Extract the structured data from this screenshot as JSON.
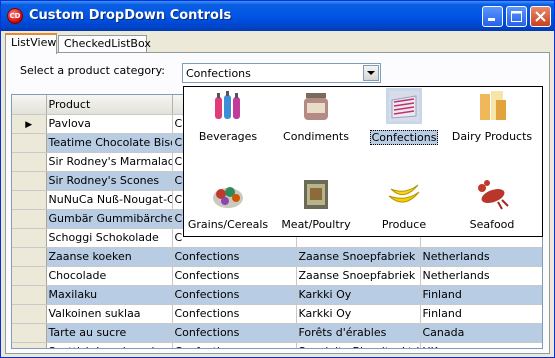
{
  "window": {
    "title": "Custom DropDown Controls",
    "icon": "app-logo-icon",
    "buttons": [
      "minimize-icon",
      "maximize-icon",
      "close-icon"
    ]
  },
  "tabs": [
    {
      "label": "ListView",
      "active": true
    },
    {
      "label": "CheckedListBox",
      "active": false
    }
  ],
  "category": {
    "label": "Select a product category:",
    "selected": "Confections"
  },
  "popup": {
    "items": [
      {
        "label": "Beverages",
        "icon": "bottles-icon"
      },
      {
        "label": "Condiments",
        "icon": "jar-icon"
      },
      {
        "label": "Confections",
        "icon": "candy-icon",
        "selected": true
      },
      {
        "label": "Dairy Products",
        "icon": "dairy-icon"
      },
      {
        "label": "Grains/Cereals",
        "icon": "cereals-icon"
      },
      {
        "label": "Meat/Poultry",
        "icon": "meat-icon"
      },
      {
        "label": "Produce",
        "icon": "bananas-icon"
      },
      {
        "label": "Seafood",
        "icon": "lobster-icon"
      }
    ]
  },
  "grid": {
    "columns": [
      "Product",
      "",
      "",
      ""
    ],
    "current_row_marker": "▶",
    "rows": [
      [
        "Pavlova",
        "C",
        "",
        ""
      ],
      [
        "Teatime Chocolate Bisc",
        "C",
        "",
        ""
      ],
      [
        "Sir Rodney's Marmalade",
        "C",
        "",
        ""
      ],
      [
        "Sir Rodney's Scones",
        "C",
        "",
        ""
      ],
      [
        "NuNuCa Nuß-Nougat-Cr",
        "C",
        "",
        ""
      ],
      [
        "Gumbär Gummibärchen",
        "C",
        "",
        ""
      ],
      [
        "Schoggi Schokolade",
        "C",
        "",
        ""
      ],
      [
        "Zaanse koeken",
        "Confections",
        "Zaanse Snoepfabriek",
        "Netherlands"
      ],
      [
        "Chocolade",
        "Confections",
        "Zaanse Snoepfabriek",
        "Netherlands"
      ],
      [
        "Maxilaku",
        "Confections",
        "Karkki Oy",
        "Finland"
      ],
      [
        "Valkoinen suklaa",
        "Confections",
        "Karkki Oy",
        "Finland"
      ],
      [
        "Tarte au sucre",
        "Confections",
        "Forêts d'érables",
        "Canada"
      ],
      [
        "Scottish Longbreads",
        "Confections",
        "Specialty Biscuits, Ltd.",
        "UK"
      ]
    ]
  },
  "colors": {
    "alt_row": "#b8cce4",
    "title_bar": "#0055e5",
    "tab_highlight": "#e68b2c"
  }
}
